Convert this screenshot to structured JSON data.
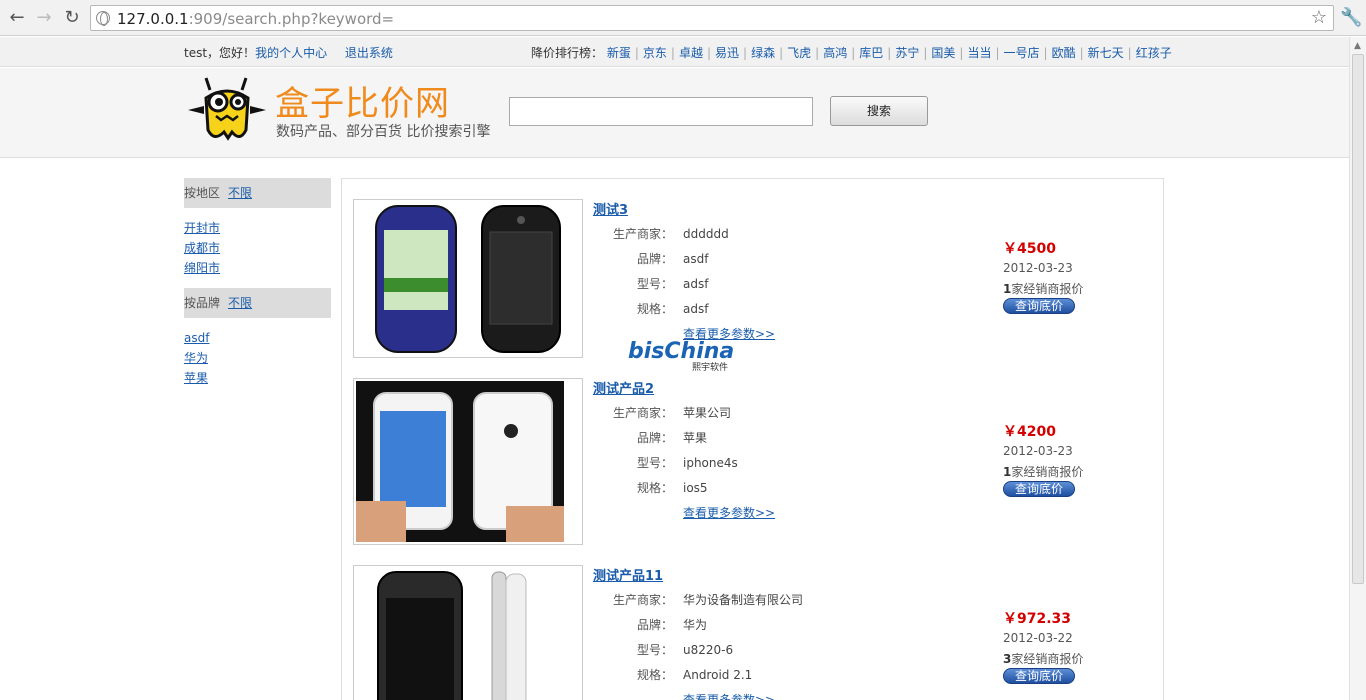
{
  "browser": {
    "url_host": "127.0.0.1",
    "url_rest": ":909/search.php?keyword="
  },
  "topbar": {
    "user": "test",
    "greeting": "，您好！",
    "profile_link": "我的个人中心",
    "logout_link": "退出系统",
    "ranking_label": "降价排行榜：",
    "stores": [
      "新蛋",
      "京东",
      "卓越",
      "易迅",
      "绿森",
      "飞虎",
      "高鸿",
      "库巴",
      "苏宁",
      "国美",
      "当当",
      "一号店",
      "欧酷",
      "新七天",
      "红孩子"
    ]
  },
  "header": {
    "site_name": "盒子比价网",
    "tagline": "数码产品、部分百货 比价搜索引擎",
    "search_value": "",
    "search_button": "搜索"
  },
  "sidebar": {
    "region_label": "按地区",
    "region_any": "不限",
    "regions": [
      "开封市",
      "成都市",
      "绵阳市"
    ],
    "brand_label": "按品牌",
    "brand_any": "不限",
    "brands": [
      "asdf",
      "华为",
      "苹果"
    ]
  },
  "labels": {
    "maker": "生产商家：",
    "brand": "品牌：",
    "model": "型号：",
    "spec": "规格：",
    "more": "查看更多参数>>",
    "dealers_suffix": "家经销商报价",
    "query": "查询底价"
  },
  "products": [
    {
      "title": "测试3",
      "maker": "dddddd",
      "brand": "asdf",
      "model": "adsf",
      "spec": "adsf",
      "price": "￥4500",
      "date": "2012-03-23",
      "dealers": "1"
    },
    {
      "title": "测试产品2",
      "maker": "苹果公司",
      "brand": "苹果",
      "model": "iphone4s",
      "spec": "ios5",
      "price": "￥4200",
      "date": "2012-03-23",
      "dealers": "1"
    },
    {
      "title": "测试产品11",
      "maker": "华为设备制造有限公司",
      "brand": "华为",
      "model": "u8220-6",
      "spec": "Android 2.1",
      "price": "￥972.33",
      "date": "2012-03-22",
      "dealers": "3"
    }
  ],
  "watermark": {
    "brand": "bisChina",
    "sub": "熙宇软件"
  }
}
